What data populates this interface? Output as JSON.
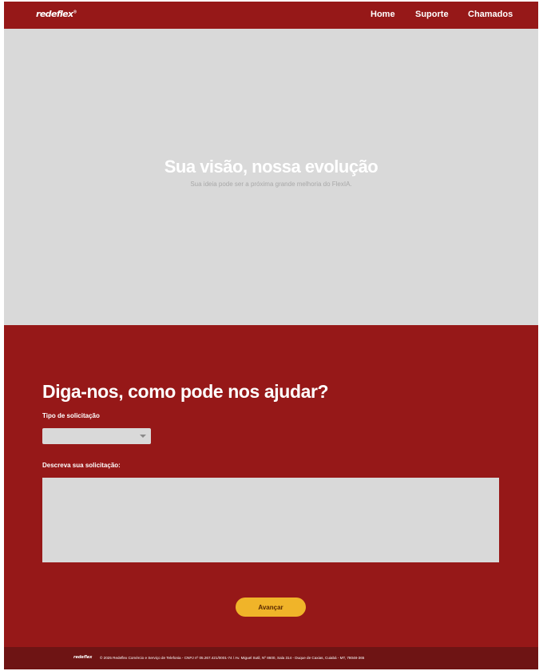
{
  "header": {
    "logo_text": "redeflex",
    "logo_mark": "®",
    "nav": {
      "home": "Home",
      "support": "Suporte",
      "tickets": "Chamados"
    }
  },
  "hero": {
    "title": "Sua visão, nossa evolução",
    "subtitle": "Sua ideia pode ser a próxima grande melhoria do FlexIA."
  },
  "form": {
    "title": "Diga-nos, como pode nos ajudar?",
    "request_type_label": "Tipo de solicitação",
    "request_type_value": "",
    "description_label": "Descreva sua solicitação:",
    "description_value": "",
    "description_placeholder": "",
    "submit_label": "Avançar"
  },
  "footer": {
    "logo_text": "redeflex",
    "legal_text": "© 2025 Redeflex Comércio e Serviço de Telefonia - CNPJ nº 05.267.421/0001-74 / Av. Miguel Sutil, Nº 8600, Sala 314 - Duque de Caxias, Cuiabá - MT, 78048-365"
  },
  "colors": {
    "brand_red": "#961818",
    "footer_red": "#6e1414",
    "hero_gray": "#d9d9d9",
    "button_yellow": "#f0b429"
  }
}
